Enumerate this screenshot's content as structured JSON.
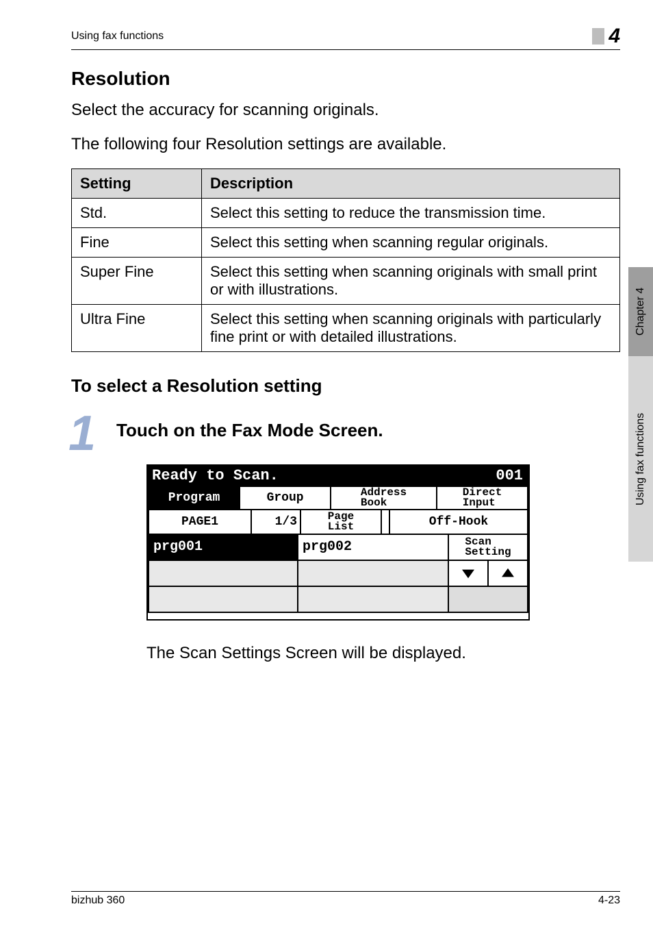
{
  "header": {
    "section": "Using fax functions",
    "chapter_number": "4"
  },
  "section_title": "Resolution",
  "intro1": "Select the accuracy for scanning originals.",
  "intro2": "The following four Resolution settings are available.",
  "table": {
    "head_setting": "Setting",
    "head_desc": "Description",
    "rows": [
      {
        "setting": "Std.",
        "desc": "Select this setting to reduce the transmission time."
      },
      {
        "setting": "Fine",
        "desc": "Select this setting when scanning regular originals."
      },
      {
        "setting": "Super Fine",
        "desc": "Select this setting when scanning originals with small print or with illustrations."
      },
      {
        "setting": "Ultra Fine",
        "desc": "Select this setting when scanning originals with particularly fine print or with detailed illustrations."
      }
    ]
  },
  "subsection_title": "To select a Resolution setting",
  "step": {
    "number": "1",
    "text": "Touch on the Fax Mode Screen."
  },
  "lcd": {
    "status_left": "Ready to Scan.",
    "status_right": "001",
    "tabs": {
      "program": "Program",
      "group": "Group",
      "address": "Address\nBook",
      "direct": "Direct\nInput"
    },
    "page_label": "PAGE1",
    "page_count": "1/3",
    "page_list": "Page\nList",
    "off_hook": "Off-Hook",
    "prg_selected": "prg001",
    "prg_other": "prg002",
    "scan_setting": "Scan\nSetting",
    "arrow_down": "↓",
    "arrow_up": "↑"
  },
  "after_image": "The Scan Settings Screen will be displayed.",
  "side": {
    "chapter": "Chapter 4",
    "title": "Using fax functions"
  },
  "footer": {
    "left": "bizhub 360",
    "right": "4-23"
  }
}
